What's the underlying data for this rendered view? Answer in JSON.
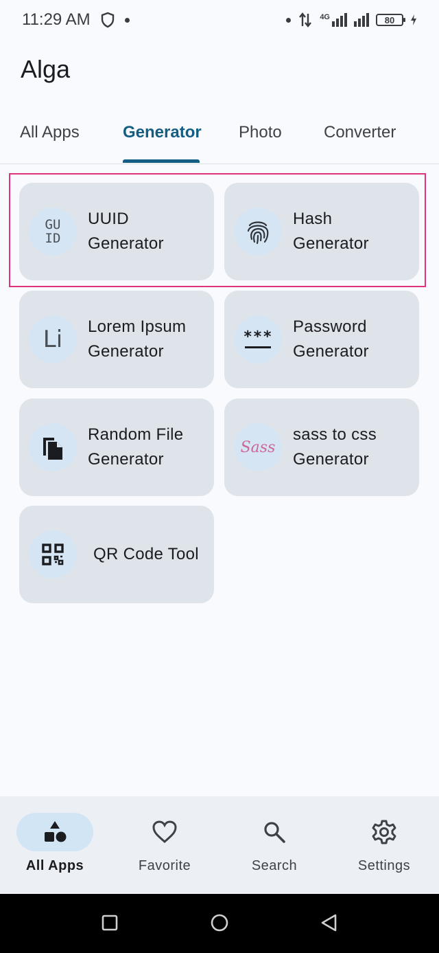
{
  "status_bar": {
    "time": "11:29 AM",
    "network": "4G",
    "battery": "80"
  },
  "app": {
    "title": "Alga"
  },
  "tabs": [
    {
      "label": "All Apps",
      "active": false
    },
    {
      "label": "Generator",
      "active": true
    },
    {
      "label": "Photo",
      "active": false
    },
    {
      "label": "Converter",
      "active": false
    }
  ],
  "cards": [
    {
      "label": "UUID\nGenerator",
      "icon": "guid-icon",
      "icon_text": "GU\nID"
    },
    {
      "label": "Hash\nGenerator",
      "icon": "fingerprint-icon"
    },
    {
      "label": "Lorem Ipsum\nGenerator",
      "icon": "lorem-icon",
      "icon_text": "Li"
    },
    {
      "label": "Password\nGenerator",
      "icon": "password-icon",
      "icon_text": "***"
    },
    {
      "label": "Random File\nGenerator",
      "icon": "file-copy-icon"
    },
    {
      "label": "sass to css\nGenerator",
      "icon": "sass-logo-icon",
      "icon_text": "Sass"
    },
    {
      "label": "QR Code Tool",
      "icon": "qr-code-icon"
    }
  ],
  "bottom_nav": [
    {
      "label": "All Apps",
      "icon": "shapes-icon",
      "active": true
    },
    {
      "label": "Favorite",
      "icon": "heart-icon",
      "active": false
    },
    {
      "label": "Search",
      "icon": "search-icon",
      "active": false
    },
    {
      "label": "Settings",
      "icon": "gear-icon",
      "active": false
    }
  ],
  "colors": {
    "accent": "#145e83",
    "card_bg": "#dfe3ea",
    "icon_bg": "#d6e5f3",
    "highlight": "#e0327b",
    "sass_pink": "#cd6799"
  }
}
